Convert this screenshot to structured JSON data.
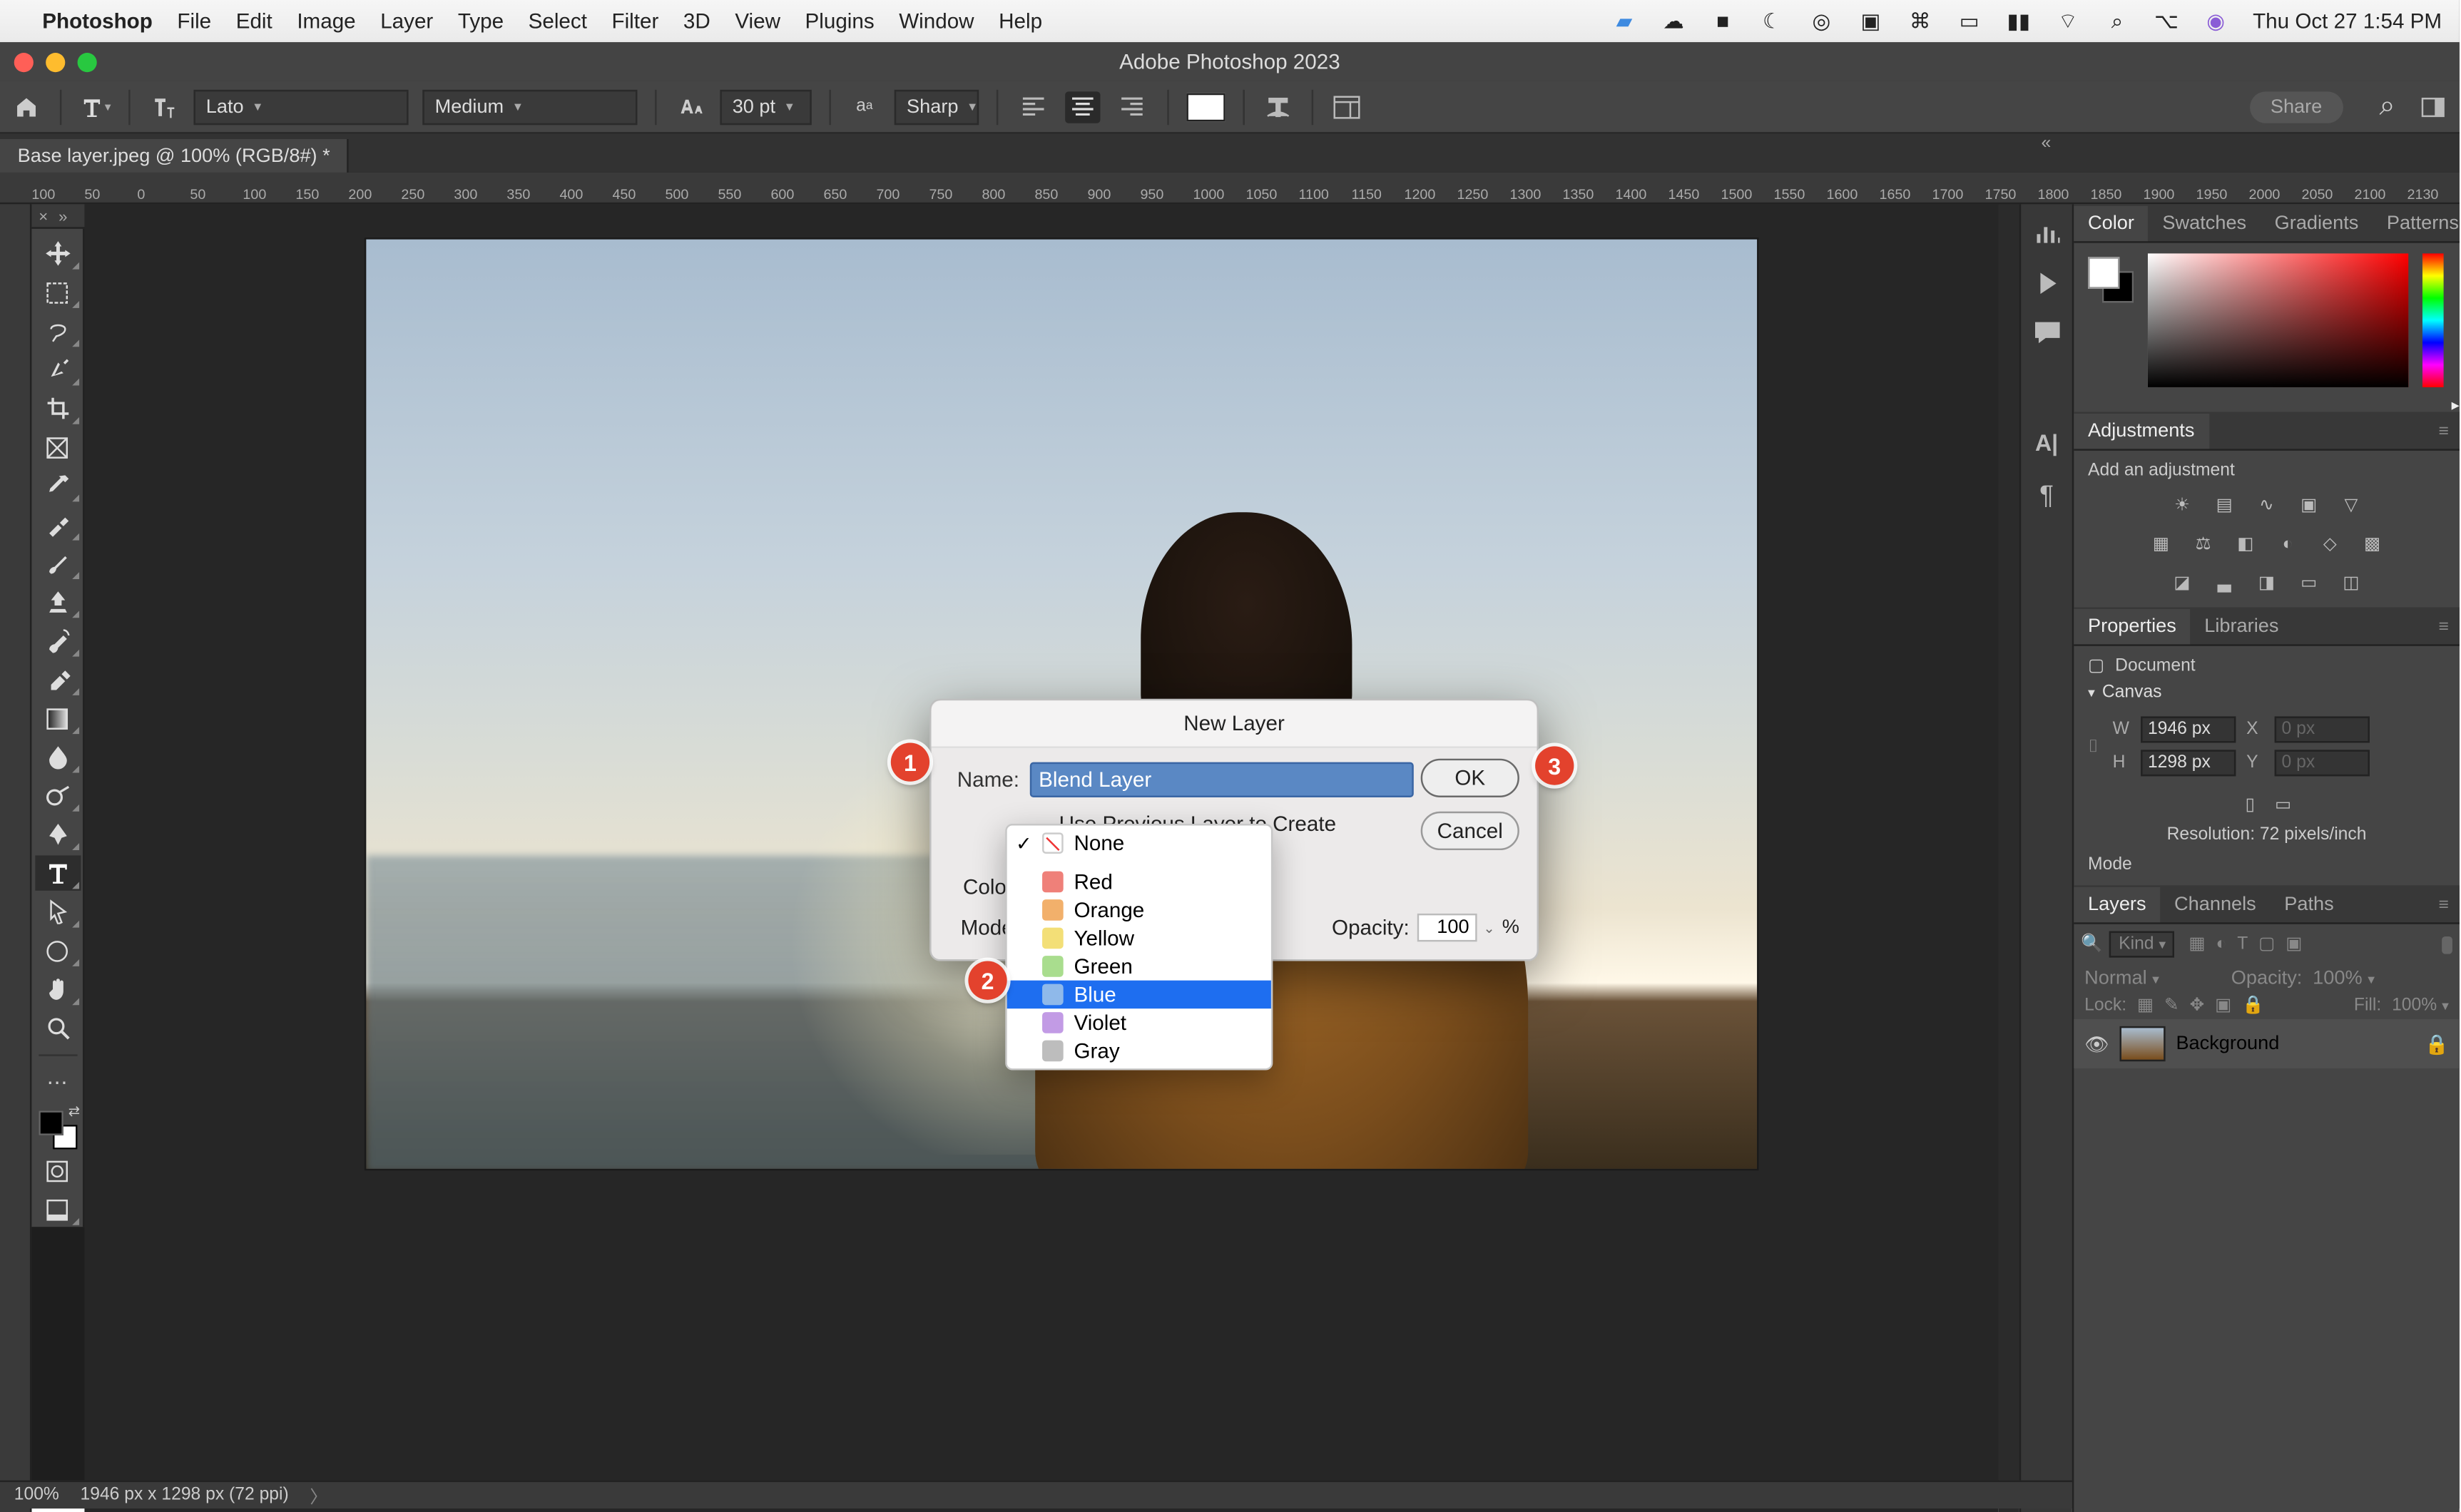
{
  "menubar": {
    "app": "Photoshop",
    "items": [
      "File",
      "Edit",
      "Image",
      "Layer",
      "Type",
      "Select",
      "Filter",
      "3D",
      "View",
      "Plugins",
      "Window",
      "Help"
    ],
    "clock": "Thu Oct 27  1:54 PM"
  },
  "window": {
    "title": "Adobe Photoshop 2023"
  },
  "options": {
    "font_family": "Lato",
    "font_weight": "Medium",
    "font_size": "30 pt",
    "aa": "Sharp",
    "share": "Share"
  },
  "doc_tab": {
    "label": "Base layer.jpeg @ 100% (RGB/8#) *"
  },
  "ruler_ticks": [
    "100",
    "50",
    "0",
    "50",
    "100",
    "150",
    "200",
    "250",
    "300",
    "350",
    "400",
    "450",
    "500",
    "550",
    "600",
    "650",
    "700",
    "750",
    "800",
    "850",
    "900",
    "950",
    "1000",
    "1050",
    "1100",
    "1150",
    "1200",
    "1250",
    "1300",
    "1350",
    "1400",
    "1450",
    "1500",
    "1550",
    "1600",
    "1650",
    "1700",
    "1750",
    "1800",
    "1850",
    "1900",
    "1950",
    "2000",
    "2050",
    "2100",
    "2130"
  ],
  "panels": {
    "color_tabs": [
      "Color",
      "Swatches",
      "Gradients",
      "Patterns"
    ],
    "adjustments_tab": "Adjustments",
    "adjustments_hint": "Add an adjustment",
    "props_tabs": [
      "Properties",
      "Libraries"
    ],
    "props_doc": "Document",
    "canvas_head": "Canvas",
    "W": "W",
    "Wv": "1946 px",
    "X": "X",
    "Xv": "0 px",
    "H": "H",
    "Hv": "1298 px",
    "Y": "Y",
    "Yv": "0 px",
    "resolution": "Resolution: 72 pixels/inch",
    "mode": "Mode",
    "layers_tabs": [
      "Layers",
      "Channels",
      "Paths"
    ],
    "kind": "Kind",
    "blend_mode": "Normal",
    "opacity_lbl": "Opacity:",
    "opacity_val": "100%",
    "lock_lbl": "Lock:",
    "fill_lbl": "Fill:",
    "fill_val": "100%",
    "layer_name": "Background"
  },
  "status": {
    "zoom": "100%",
    "info": "1946 px x 1298 px (72 ppi)"
  },
  "dialog": {
    "title": "New Layer",
    "name_lbl": "Name:",
    "name_val": "Blend Layer",
    "ok": "OK",
    "cancel": "Cancel",
    "clip": "Use Previous Layer to Create Clipping Mask",
    "color_lbl": "Color:",
    "mode_lbl": "Mode:",
    "opacity_lbl": "Opacity:",
    "opacity_val": "100",
    "pct": "%"
  },
  "dropdown": {
    "items": [
      "None",
      "Red",
      "Orange",
      "Yellow",
      "Green",
      "Blue",
      "Violet",
      "Gray"
    ],
    "checked": "None",
    "highlighted": "Blue"
  },
  "annotations": {
    "a1": "1",
    "a2": "2",
    "a3": "3"
  }
}
